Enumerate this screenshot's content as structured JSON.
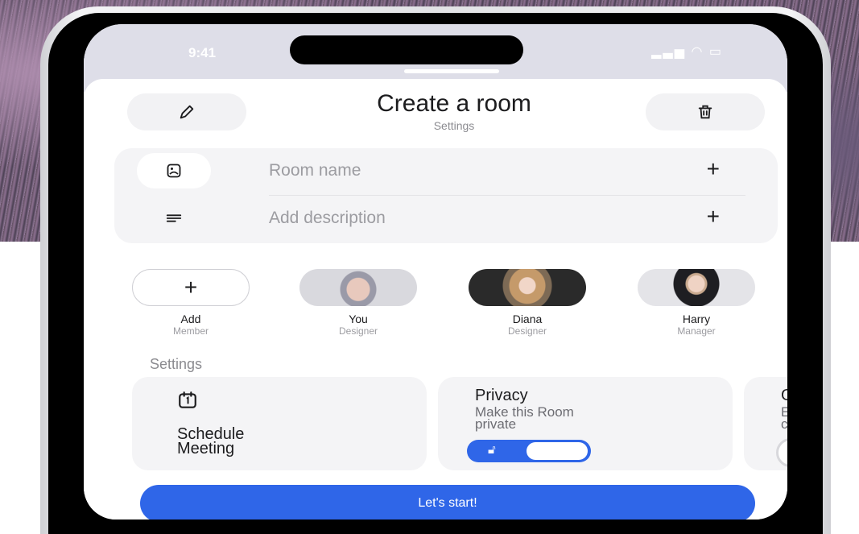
{
  "status": {
    "time": "9:41"
  },
  "header": {
    "title": "Create a room",
    "subtitle": "Settings",
    "edit_icon": "pencil-icon",
    "delete_icon": "trash-icon"
  },
  "form": {
    "room_name": {
      "label": "Room name",
      "icon": "image-icon",
      "action": "+"
    },
    "description": {
      "label": "Add description",
      "icon": "text-lines-icon",
      "action": "+"
    }
  },
  "members": [
    {
      "name": "Add",
      "role": "Member",
      "type": "add",
      "symbol": "+"
    },
    {
      "name": "You",
      "role": "Designer",
      "type": "avatar"
    },
    {
      "name": "Diana",
      "role": "Designer",
      "type": "avatar"
    },
    {
      "name": "Harry",
      "role": "Manager",
      "type": "avatar"
    }
  ],
  "settings": {
    "label": "Settings",
    "cards": [
      {
        "title": "Schedule\nMeeting",
        "icon": "calendar-icon"
      },
      {
        "title": "Privacy",
        "subtitle": "Make this Room\nprivate",
        "toggle_on": true
      },
      {
        "title": "G",
        "subtitle": "En\nco",
        "toggle_on": false
      }
    ]
  },
  "cta": {
    "label": "Let's start!"
  },
  "colors": {
    "accent": "#2f66e8",
    "surface": "#f4f4f6",
    "text": "#1c1c1e",
    "muted": "#9c9ca1"
  }
}
